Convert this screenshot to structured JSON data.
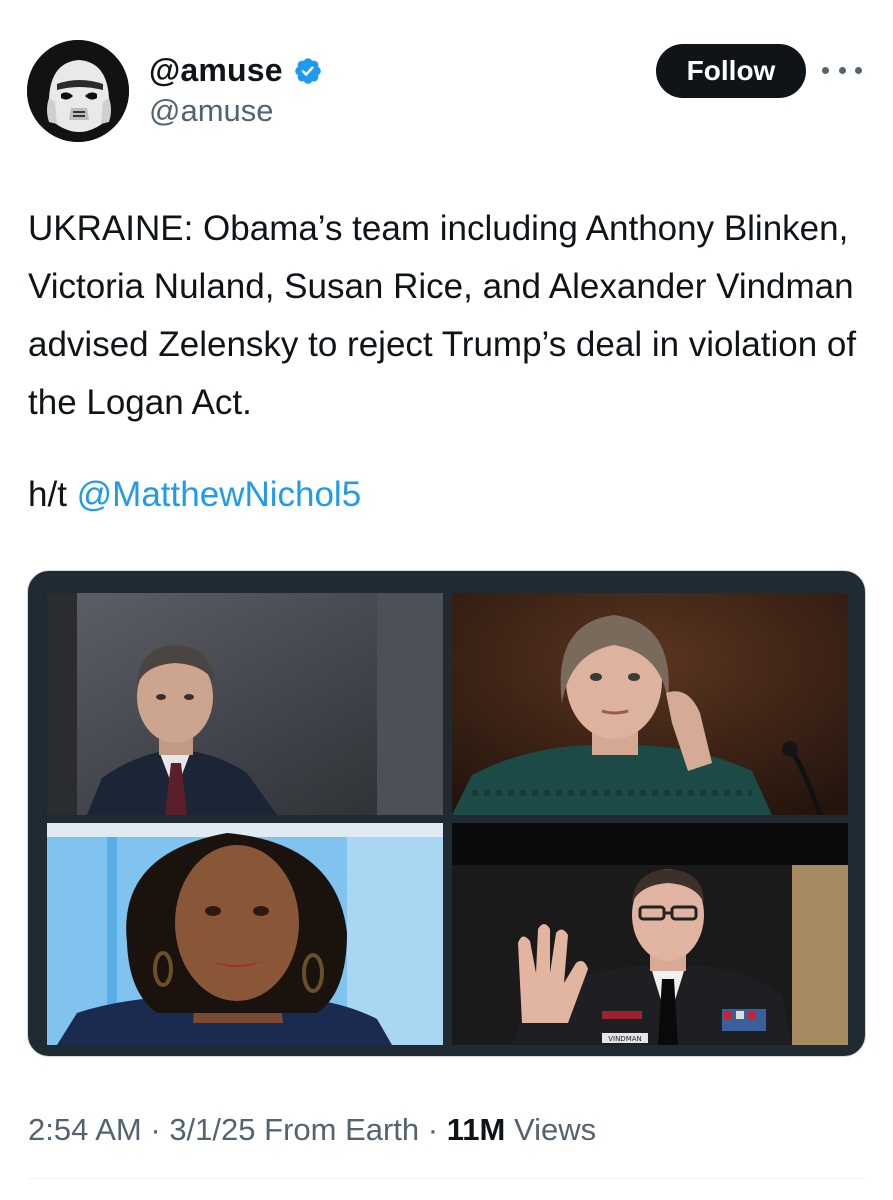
{
  "author": {
    "display_name": "@amuse",
    "handle": "@amuse",
    "verified": true,
    "avatar_icon": "stormtrooper-avatar"
  },
  "actions": {
    "follow_label": "Follow",
    "more_icon": "more-options-icon"
  },
  "tweet": {
    "text": "UKRAINE: Obama’s team including Anthony Blinken, Victoria Nuland, Susan Rice, and Alexander Vindman advised Zelensky to reject Trump’s deal in violation of the Logan Act.",
    "ht_prefix": "h/t ",
    "mention": "@MatthewNichol5"
  },
  "media": {
    "photos": [
      {
        "position": "top-left",
        "subject": "man in dark suit"
      },
      {
        "position": "top-right",
        "subject": "woman at hearing"
      },
      {
        "position": "bottom-left",
        "subject": "woman smiling"
      },
      {
        "position": "bottom-right",
        "subject": "officer in uniform taking oath"
      }
    ],
    "uniform_nametag": "VINDMAN"
  },
  "meta": {
    "time": "2:54 AM",
    "sep1": " · ",
    "date": "3/1/25",
    "source": " From Earth",
    "sep2": " · ",
    "views_count": "11M",
    "views_label": " Views"
  },
  "colors": {
    "text": "#0f1419",
    "secondary": "#536471",
    "link": "#1d9bf0",
    "verified": "#1d9bf0",
    "follow_bg": "#0f1419"
  }
}
